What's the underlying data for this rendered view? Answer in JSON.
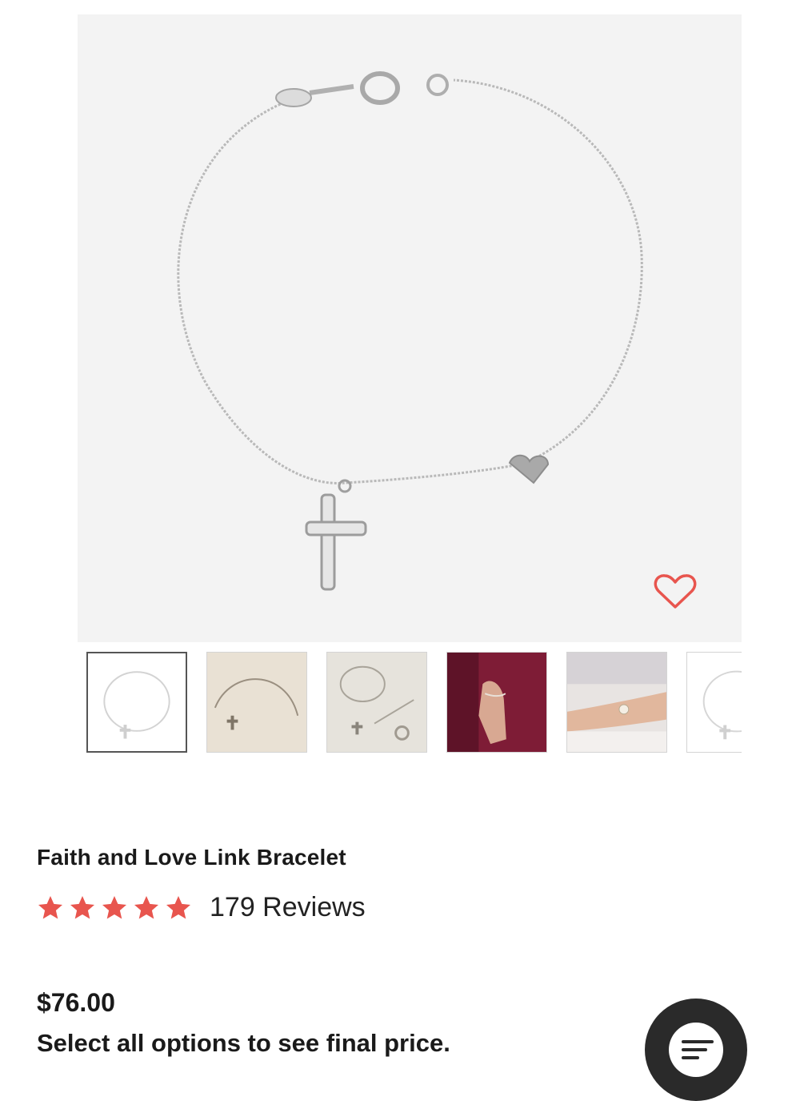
{
  "product": {
    "title": "Faith and Love Link Bracelet",
    "rating": 5,
    "review_count_label": "179 Reviews",
    "price": "$76.00",
    "price_note": "Select all options to see final price."
  },
  "gallery": {
    "main_image": "bracelet-cross-heart-silver",
    "thumbnails": [
      "bracelet-white-background",
      "bracelet-on-linen",
      "bracelet-jewelry-set",
      "bracelet-on-wrist-red-dress",
      "bracelets-on-wrist-lace",
      "bracelet-white-background-alt"
    ],
    "selected_index": 0
  },
  "icons": {
    "wishlist": "heart-outline-icon",
    "star": "star-icon",
    "chat": "chat-icon"
  },
  "colors": {
    "accent": "#e8554e",
    "star": "#e8554e",
    "fab": "#2a2a2a",
    "hero_bg": "#f3f3f3"
  }
}
